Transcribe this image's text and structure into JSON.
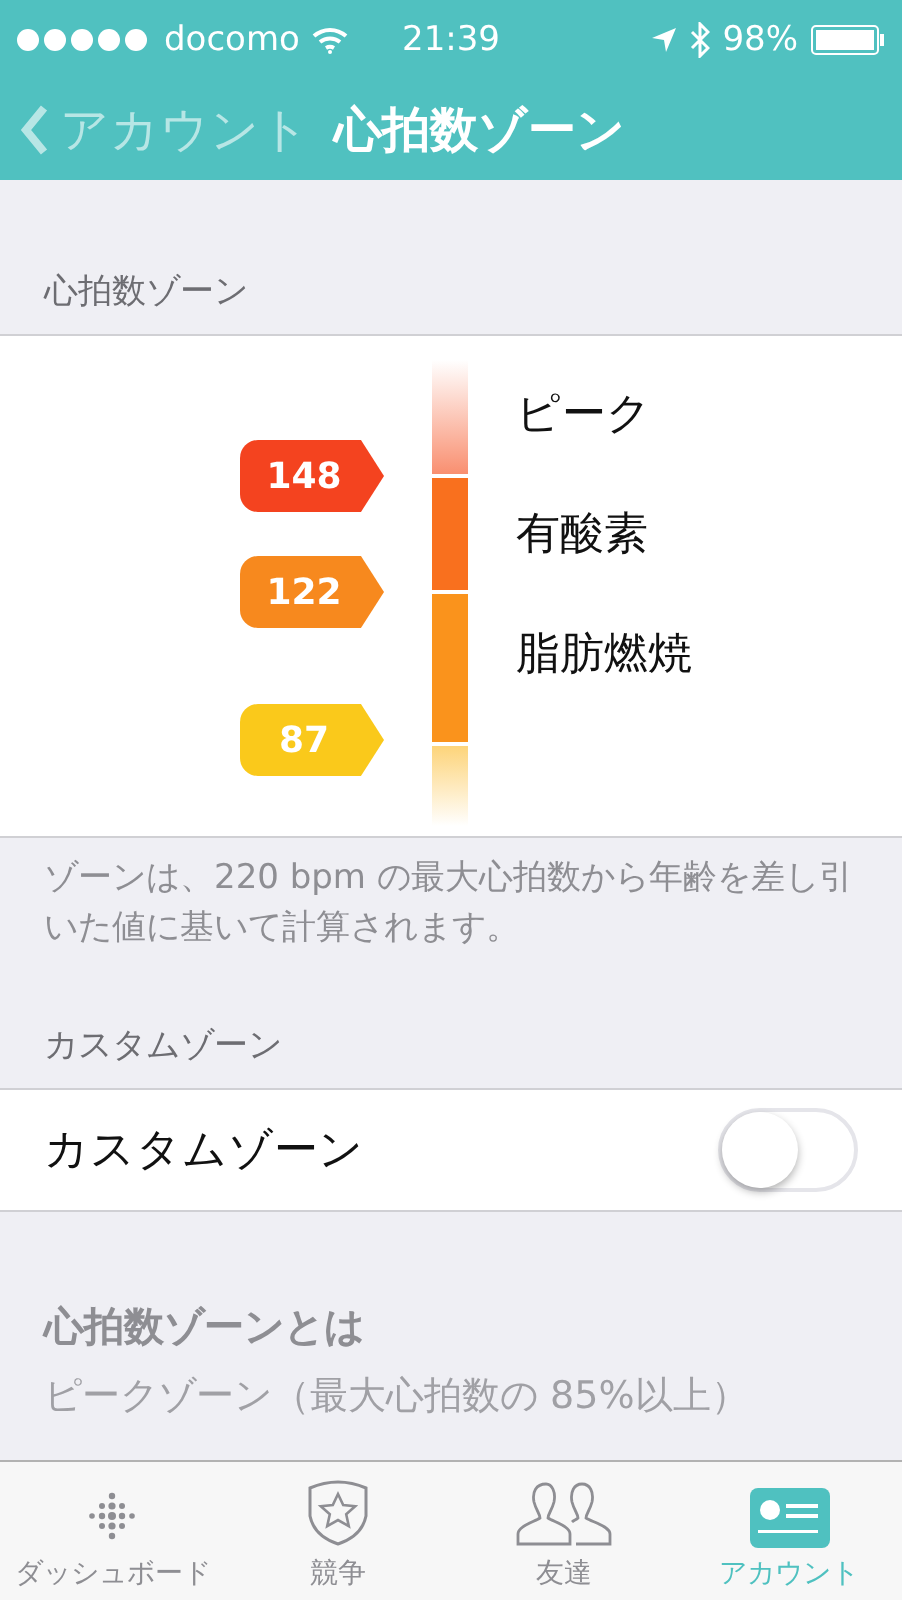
{
  "status_bar": {
    "carrier": "docomo",
    "time": "21:39",
    "battery": "98%"
  },
  "nav": {
    "back": "アカウント",
    "title": "心拍数ゾーン"
  },
  "zones_section": {
    "header": "心拍数ゾーン",
    "zones": [
      {
        "name": "ピーク",
        "color": "#f98f70"
      },
      {
        "name": "有酸素",
        "color": "#f9701e"
      },
      {
        "name": "脂肪燃焼",
        "color": "#fa931c"
      }
    ],
    "thresholds": [
      {
        "value": "148",
        "color": "#f4431f"
      },
      {
        "value": "122",
        "color": "#f7891e"
      },
      {
        "value": "87",
        "color": "#fac91b"
      }
    ],
    "note": "ゾーンは、220 bpm の最大心拍数から年齢を差し引いた値に基いて計算されます。"
  },
  "custom_section": {
    "header": "カスタムゾーン",
    "label": "カスタムゾーン",
    "on": false
  },
  "about": {
    "title": "心拍数ゾーンとは",
    "text": "ピークゾーン（最大心拍数の 85%以上）"
  },
  "tabs": [
    {
      "label": "ダッシュボード",
      "kind": "dashboard",
      "selected": false
    },
    {
      "label": "競争",
      "kind": "challenge",
      "selected": false
    },
    {
      "label": "友達",
      "kind": "friends",
      "selected": false
    },
    {
      "label": "アカウント",
      "kind": "account",
      "selected": true
    }
  ]
}
